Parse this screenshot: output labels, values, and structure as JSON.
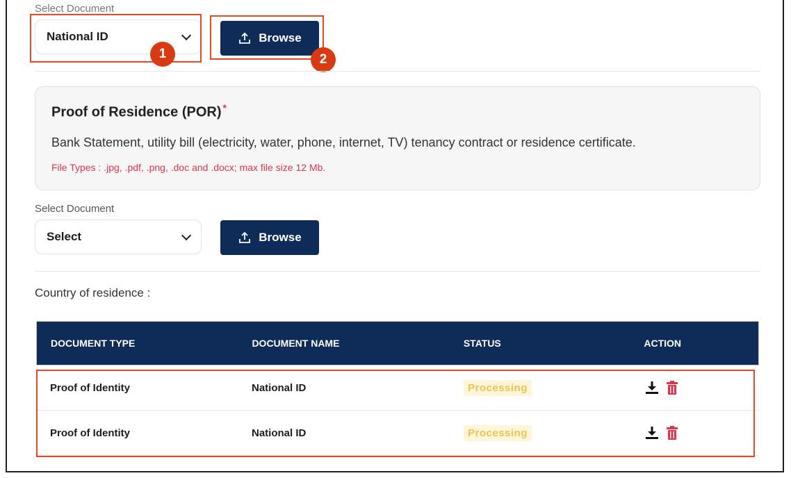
{
  "top": {
    "select_label": "Select Document",
    "select_value": "National ID",
    "browse_label": "Browse"
  },
  "annotations": {
    "badge1": "1",
    "badge2": "2",
    "highlight_color": "#e8461e"
  },
  "por": {
    "title": "Proof of Residence (POR)",
    "required_mark": "*",
    "description": "Bank Statement, utility bill (electricity, water, phone, internet, TV) tenancy contract or residence certificate.",
    "file_types": "File Types : .jpg, .pdf, .png, .doc and .docx; max file size 12 Mb.",
    "select_label": "Select Document",
    "select_value": "Select",
    "browse_label": "Browse"
  },
  "country_label": "Country of residence :",
  "table": {
    "headers": [
      "DOCUMENT TYPE",
      "DOCUMENT NAME",
      "STATUS",
      "ACTION"
    ],
    "rows": [
      {
        "type": "Proof of Identity",
        "name": "National ID",
        "status": "Processing"
      },
      {
        "type": "Proof of Identity",
        "name": "National ID",
        "status": "Processing"
      }
    ]
  },
  "colors": {
    "navy": "#0f2b57",
    "required_red": "#e0344e",
    "status_text": "#f0c24e",
    "status_bg": "#fff6d9",
    "delete_icon": "#e0344e"
  },
  "icons": [
    "upload-icon",
    "chevron-down-icon",
    "download-icon",
    "trash-icon"
  ]
}
